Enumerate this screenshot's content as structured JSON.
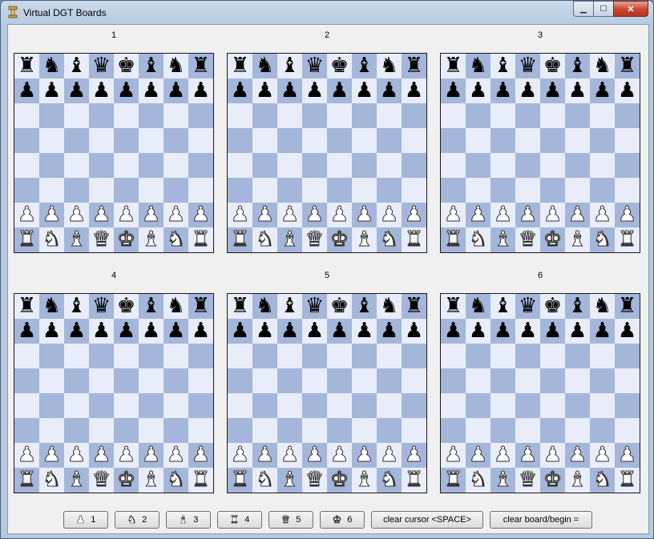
{
  "window": {
    "title": "Virtual DGT Boards",
    "min_glyph": "▁",
    "max_glyph": "☐",
    "close_glyph": "✕"
  },
  "pieces": {
    "white": {
      "K": "♚",
      "Q": "♛",
      "R": "♜",
      "B": "♝",
      "N": "♞",
      "P": "♟"
    },
    "black": {
      "k": "♚",
      "q": "♛",
      "r": "♜",
      "b": "♝",
      "n": "♞",
      "p": "♟"
    }
  },
  "boards": [
    {
      "label": "1",
      "position": [
        "rnbqkbnr",
        "pppppppp",
        "........",
        "........",
        "........",
        "........",
        "PPPPPPPP",
        "RNBQKBNR"
      ]
    },
    {
      "label": "2",
      "position": [
        "rnbqkbnr",
        "pppppppp",
        "........",
        "........",
        "........",
        "........",
        "PPPPPPPP",
        "RNBQKBNR"
      ]
    },
    {
      "label": "3",
      "position": [
        "rnbqkbnr",
        "pppppppp",
        "........",
        "........",
        "........",
        "........",
        "PPPPPPPP",
        "RNBQKBNR"
      ]
    },
    {
      "label": "4",
      "position": [
        "rnbqkbnr",
        "pppppppp",
        "........",
        "........",
        "........",
        "........",
        "PPPPPPPP",
        "RNBQKBNR"
      ]
    },
    {
      "label": "5",
      "position": [
        "rnbqkbnr",
        "pppppppp",
        "........",
        "........",
        "........",
        "........",
        "PPPPPPPP",
        "RNBQKBNR"
      ]
    },
    {
      "label": "6",
      "position": [
        "rnbqkbnr",
        "pppppppp",
        "........",
        "........",
        "........",
        "........",
        "PPPPPPPP",
        "RNBQKBNR"
      ]
    }
  ],
  "colors": {
    "light_square": "#e8edf9",
    "dark_square": "#a4b6da"
  },
  "buttons": {
    "b1": {
      "icon": "♟",
      "icon_name": "pawn-icon",
      "label": "1"
    },
    "b2": {
      "icon": "♞",
      "icon_name": "knight-icon",
      "label": "2"
    },
    "b3": {
      "icon": "♝",
      "icon_name": "bishop-icon",
      "label": "3"
    },
    "b4": {
      "icon": "♜",
      "icon_name": "rook-icon",
      "label": "4"
    },
    "b5": {
      "icon": "♛",
      "icon_name": "queen-icon",
      "label": "5"
    },
    "b6": {
      "icon": "♚",
      "icon_name": "king-icon",
      "label": "6"
    },
    "clear_cursor": "clear cursor <SPACE>",
    "clear_board": "clear board/begin ="
  }
}
